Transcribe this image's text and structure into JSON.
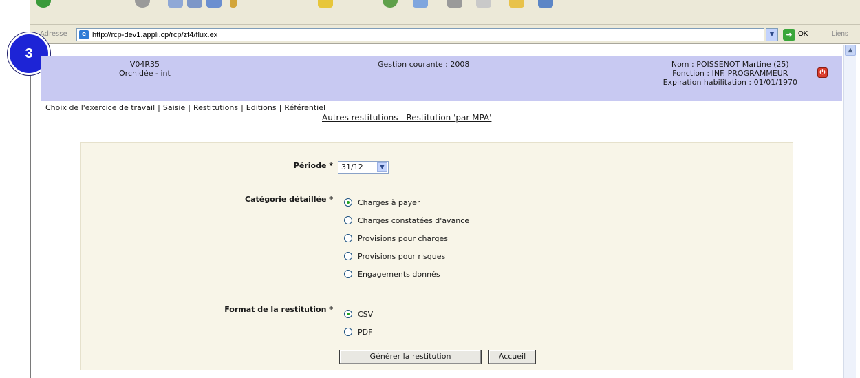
{
  "step": {
    "number": "3"
  },
  "browser": {
    "address_label": "Adresse",
    "url": "http://rcp-dev1.appli.cp/rcp/zf4/flux.ex",
    "go_label": "OK",
    "links_label": "Liens"
  },
  "header": {
    "version": "V04R35",
    "environment": "Orchidée - int",
    "gestion": "Gestion courante : 2008",
    "nom": "Nom : POISSENOT Martine (25)",
    "fonction": "Fonction : INF. PROGRAMMEUR",
    "expiration": "Expiration habilitation : 01/01/1970"
  },
  "menu": {
    "items": [
      "Choix de l'exercice de travail",
      "Saisie",
      "Restitutions",
      "Editions",
      "Référentiel"
    ],
    "separator": "|"
  },
  "page": {
    "title": "Autres restitutions - Restitution 'par MPA'"
  },
  "form": {
    "periode_label": "Période *",
    "periode_value": "31/12",
    "categorie_label": "Catégorie détaillée *",
    "categories": [
      {
        "label": "Charges à payer",
        "checked": true
      },
      {
        "label": "Charges constatées d'avance",
        "checked": false
      },
      {
        "label": "Provisions pour charges",
        "checked": false
      },
      {
        "label": "Provisions pour risques",
        "checked": false
      },
      {
        "label": "Engagements donnés",
        "checked": false
      }
    ],
    "format_label": "Format de la restitution *",
    "formats": [
      {
        "label": "CSV",
        "checked": true
      },
      {
        "label": "PDF",
        "checked": false
      }
    ],
    "generate_label": "Générer la restitution",
    "home_label": "Accueil"
  },
  "colors": {
    "header_bg": "#c8c9f2",
    "form_bg": "#f8f5e8",
    "badge": "#1d24d6"
  }
}
